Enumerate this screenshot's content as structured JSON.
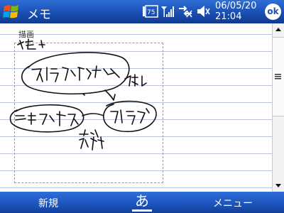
{
  "titlebar": {
    "app_title": "メモ",
    "battery_label": "75",
    "clock_date": "06/05/20",
    "clock_time": "21:04",
    "ok_label": "ok"
  },
  "content": {
    "drawing_label": "描画",
    "handwriting_text": [
      "メモ",
      "アイディアの出し方",
      "探し",
      "テキストデータ",
      "アイディア",
      "まとめ",
      "分析"
    ]
  },
  "softkeys": {
    "left": "新規",
    "input_method": "あ",
    "right": "メニュー"
  },
  "icons": {
    "start": "windows-start-icon",
    "battery": "battery-icon",
    "signal": "signal-strength-icon",
    "connectivity": "connectivity-off-icon",
    "volume": "speaker-icon",
    "ok": "ok-icon",
    "scroll_up": "scroll-up-icon",
    "scroll_down": "scroll-down-icon",
    "scroll_grip": "scroll-grip-icon"
  },
  "colors": {
    "titlebar": "#1a4fb2",
    "softbar": "#1c53bc",
    "ruled_lines": "#b9c6d8",
    "ink": "#111111"
  }
}
